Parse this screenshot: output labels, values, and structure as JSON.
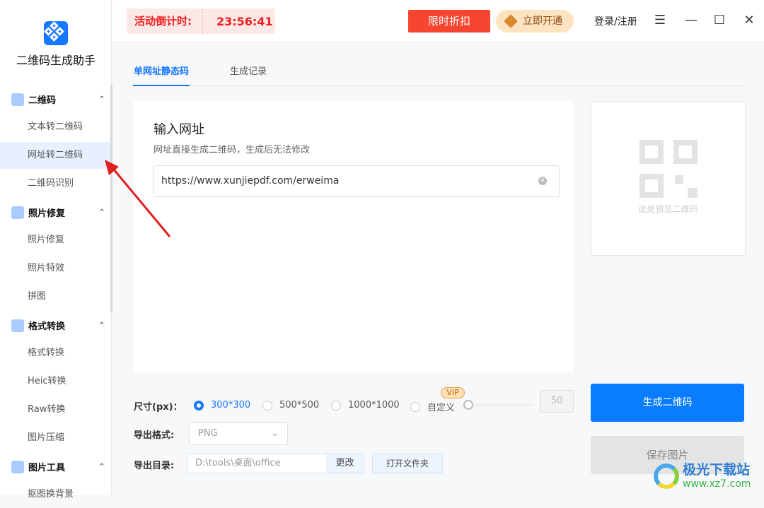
{
  "app": {
    "name": "二维码生成助手"
  },
  "sidebar": {
    "groups": [
      {
        "label": "二维码",
        "items": [
          "文本转二维码",
          "网址转二维码",
          "二维码识别"
        ]
      },
      {
        "label": "照片修复",
        "items": [
          "照片修复",
          "照片特效",
          "拼图"
        ]
      },
      {
        "label": "格式转换",
        "items": [
          "格式转换",
          "Heic转换",
          "Raw转换",
          "图片压缩"
        ]
      },
      {
        "label": "图片工具",
        "items": [
          "抠图换背景"
        ]
      }
    ],
    "active": "网址转二维码"
  },
  "topbar": {
    "countdown_label": "活动倒计时:",
    "countdown": "23:56:41",
    "promo": "限时折扣",
    "vip": "立即开通",
    "login": "登录/注册"
  },
  "tabs": [
    "单网址静态码",
    "生成记录"
  ],
  "card": {
    "title": "输入网址",
    "subtitle": "网址直接生成二维码，生成后无法修改",
    "url": "https://www.xunjiepdf.com/erweima"
  },
  "preview": {
    "placeholder": "此处预览二维码"
  },
  "options": {
    "size_label": "尺寸(px)：",
    "sizes": [
      "300*300",
      "500*500",
      "1000*1000",
      "自定义"
    ],
    "selected": "300*300",
    "vip_badge": "VIP",
    "custom_value": "50",
    "format_label": "导出格式:",
    "format": "PNG",
    "dir_label": "导出目录:",
    "dir": "D:\\tools\\桌面\\office",
    "change": "更改",
    "open_folder": "打开文件夹"
  },
  "actions": {
    "generate": "生成二维码",
    "save": "保存图片"
  },
  "watermark": {
    "name": "极光下载站",
    "url": "www.xz7.com"
  },
  "colors": {
    "accent": "#1677ff",
    "countdown": "#f01e1e",
    "promo": "#f7452f"
  }
}
